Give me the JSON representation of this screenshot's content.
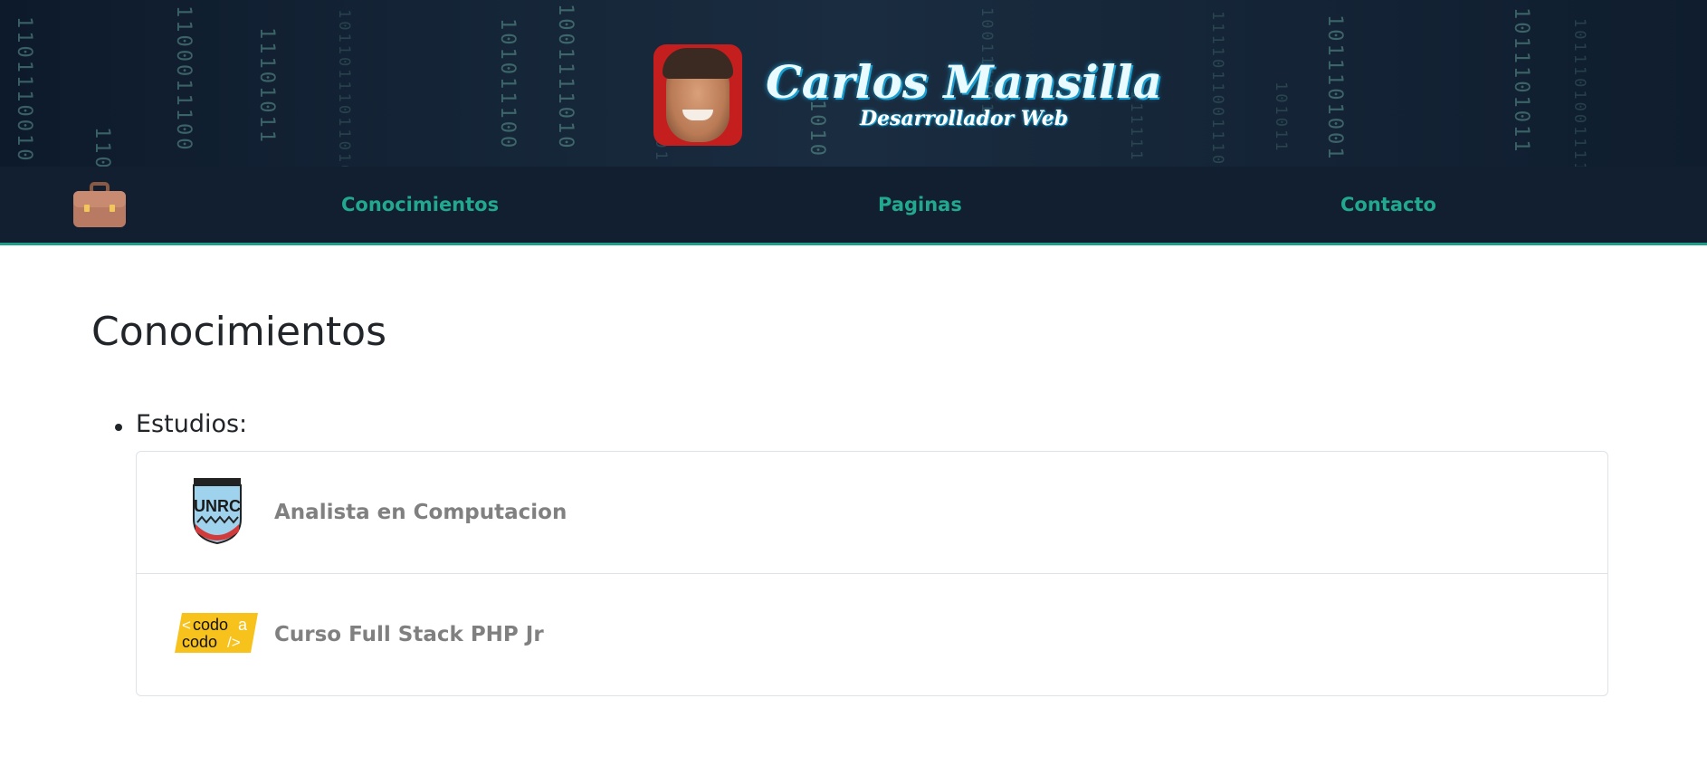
{
  "header": {
    "name": "Carlos Mansilla",
    "subtitle": "Desarrollador Web"
  },
  "nav": {
    "logo_icon": "briefcase-icon",
    "items": [
      {
        "label": "Conocimientos"
      },
      {
        "label": "Paginas"
      },
      {
        "label": "Contacto"
      }
    ],
    "accent_color": "#22a88e"
  },
  "main": {
    "title": "Conocimientos",
    "studies": {
      "label": "Estudios:",
      "items": [
        {
          "title": "Analista en Computacion",
          "logo": "unrc-shield-logo",
          "logo_text": "UNRC"
        },
        {
          "title": "Curso Full Stack PHP Jr",
          "logo": "codo-a-codo-logo",
          "logo_text": "<codoa codo/>"
        }
      ]
    }
  }
}
